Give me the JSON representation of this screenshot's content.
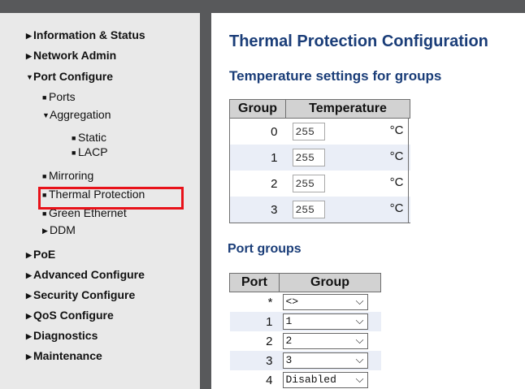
{
  "sidebar": {
    "items": [
      {
        "label": "Information & Status"
      },
      {
        "label": "Network Admin"
      },
      {
        "label": "Port Configure"
      },
      {
        "label": "PoE"
      },
      {
        "label": "Advanced Configure"
      },
      {
        "label": "Security Configure"
      },
      {
        "label": "QoS Configure"
      },
      {
        "label": "Diagnostics"
      },
      {
        "label": "Maintenance"
      }
    ],
    "port_configure_children": {
      "ports": "Ports",
      "aggregation": "Aggregation",
      "static": "Static",
      "lacp": "LACP",
      "mirroring": "Mirroring",
      "thermal_protection": "Thermal Protection",
      "green_ethernet": "Green Ethernet",
      "ddm": "DDM"
    }
  },
  "main": {
    "title": "Thermal Protection Configuration",
    "temp_section_title": "Temperature settings for groups",
    "temp_table": {
      "headers": [
        "Group",
        "Temperature"
      ],
      "unit": "°C",
      "rows": [
        {
          "group": "0",
          "temperature": "255"
        },
        {
          "group": "1",
          "temperature": "255"
        },
        {
          "group": "2",
          "temperature": "255"
        },
        {
          "group": "3",
          "temperature": "255"
        }
      ]
    },
    "port_section_title": "Port groups",
    "port_table": {
      "headers": [
        "Port",
        "Group"
      ],
      "rows": [
        {
          "port": "*",
          "group": "<>"
        },
        {
          "port": "1",
          "group": "1"
        },
        {
          "port": "2",
          "group": "2"
        },
        {
          "port": "3",
          "group": "3"
        },
        {
          "port": "4",
          "group": "Disabled"
        }
      ]
    }
  },
  "colors": {
    "heading": "#1a3d78",
    "highlight_border": "#e8121a",
    "sidebar_bg": "#e9e9e9",
    "header_bar": "#58595b"
  }
}
